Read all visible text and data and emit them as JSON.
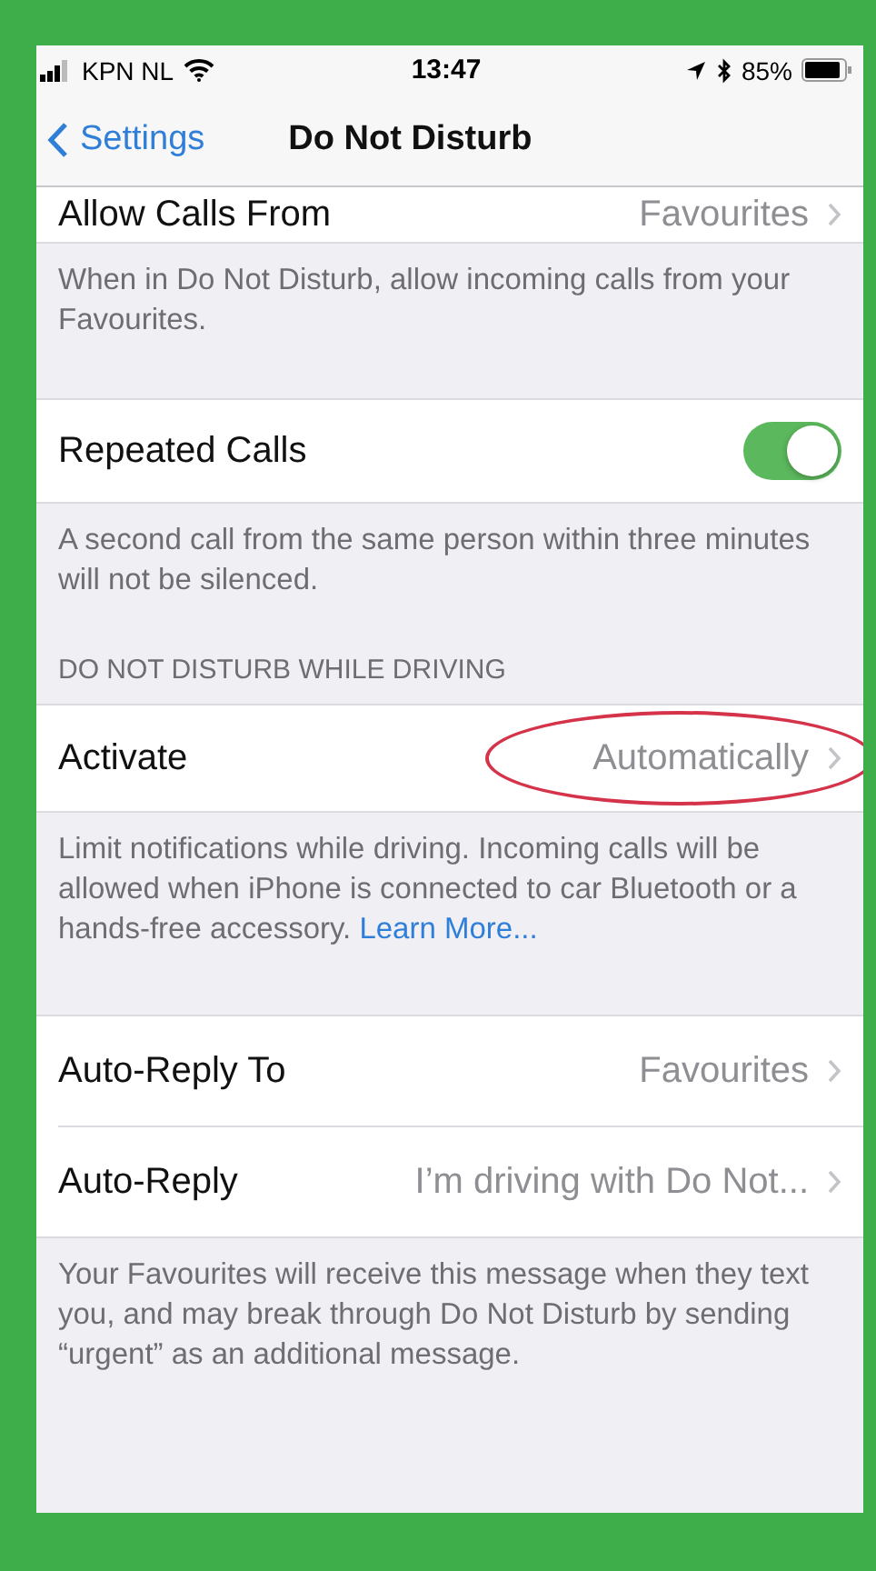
{
  "status_bar": {
    "carrier": "KPN NL",
    "time": "13:47",
    "battery": "85%"
  },
  "nav": {
    "back": "Settings",
    "title": "Do Not Disturb"
  },
  "sections": [
    {
      "rows": [
        {
          "kind": "disclosure",
          "label": "Allow Calls From",
          "value": "Favourites",
          "circled": false
        }
      ],
      "footer": {
        "text": "When in Do Not Disturb, allow incoming calls from your Favourites."
      }
    },
    {
      "rows": [
        {
          "kind": "toggle",
          "label": "Repeated Calls",
          "on": true,
          "circled": false
        }
      ],
      "footer": {
        "text": "A second call from the same person within three minutes will not be silenced."
      }
    },
    {
      "header": "DO NOT DISTURB WHILE DRIVING",
      "rows": [
        {
          "kind": "disclosure",
          "label": "Activate",
          "value": "Automatically",
          "circled": true
        }
      ],
      "footer": {
        "text": "Limit notifications while driving. Incoming calls will be allowed when iPhone is connected to car Bluetooth or a hands-free accessory.",
        "link": "Learn More..."
      }
    },
    {
      "rows": [
        {
          "kind": "disclosure",
          "label": "Auto-Reply To",
          "value": "Favourites",
          "circled": false
        },
        {
          "kind": "disclosure",
          "label": "Auto-Reply",
          "value": "I’m driving with Do Not...",
          "circled": false
        }
      ],
      "footer": {
        "text": "Your Favourites will receive this message when they text you, and may break through Do Not Disturb by sending “urgent” as an additional message."
      }
    }
  ]
}
